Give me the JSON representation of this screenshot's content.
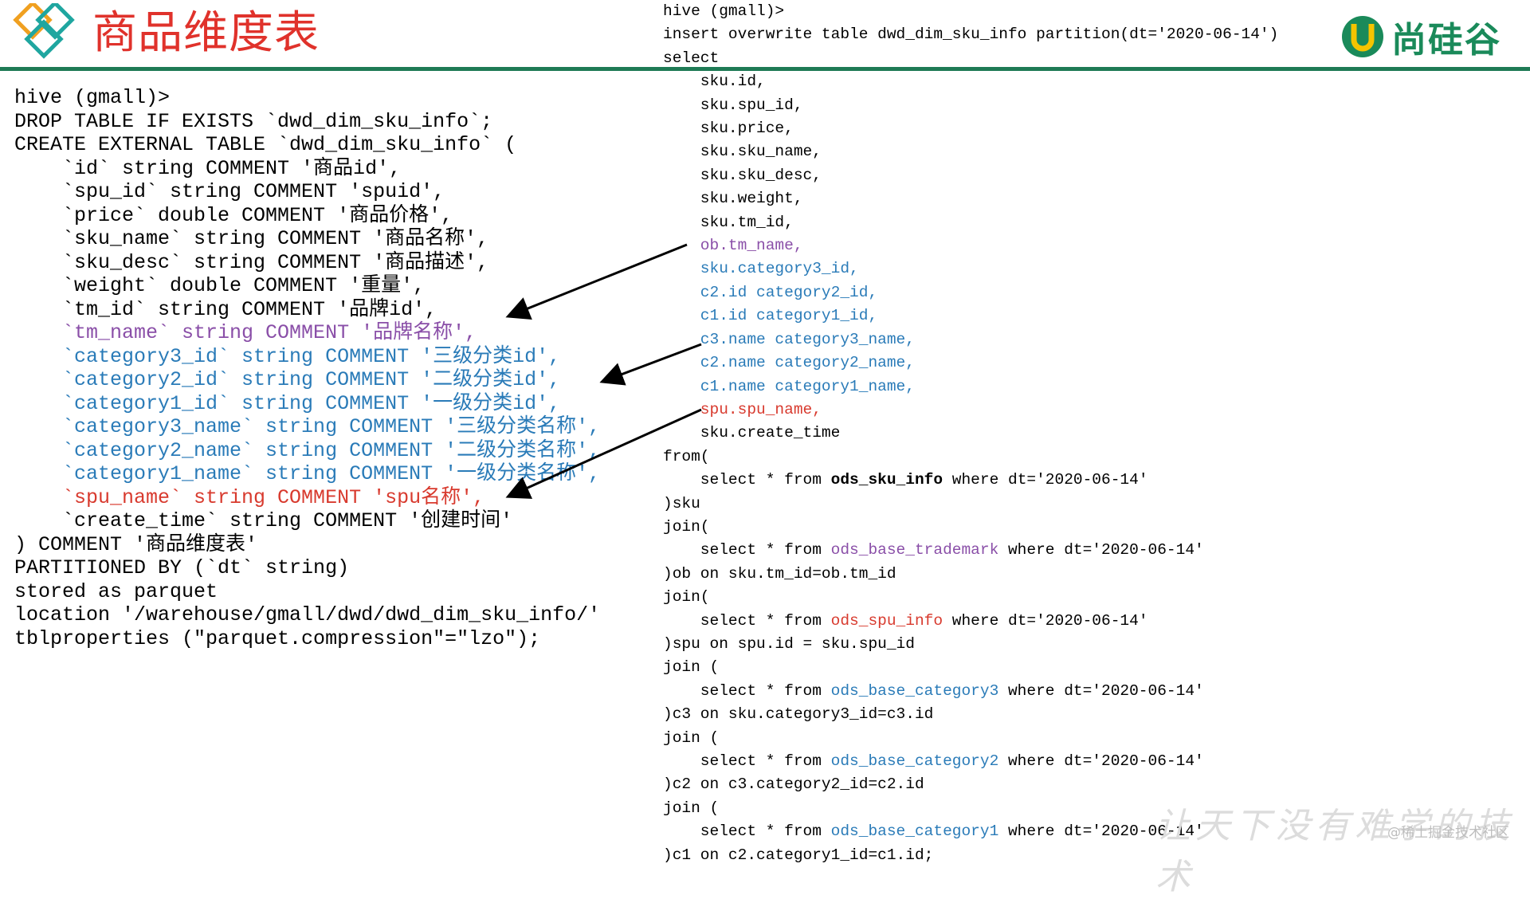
{
  "header": {
    "title": "商品维度表",
    "brand": "尚硅谷",
    "accent_color": "#1e7a55",
    "title_color": "#e0322b"
  },
  "left_code": [
    {
      "text": "hive (gmall)>",
      "color": "default"
    },
    {
      "text": "DROP TABLE IF EXISTS `dwd_dim_sku_info`;",
      "color": "default"
    },
    {
      "text": "CREATE EXTERNAL TABLE `dwd_dim_sku_info` (",
      "color": "default"
    },
    {
      "text": "    `id` string COMMENT '商品id',",
      "color": "default"
    },
    {
      "text": "    `spu_id` string COMMENT 'spuid',",
      "color": "default"
    },
    {
      "text": "    `price` double COMMENT '商品价格',",
      "color": "default"
    },
    {
      "text": "    `sku_name` string COMMENT '商品名称',",
      "color": "default"
    },
    {
      "text": "    `sku_desc` string COMMENT '商品描述',",
      "color": "default"
    },
    {
      "text": "    `weight` double COMMENT '重量',",
      "color": "default"
    },
    {
      "text": "    `tm_id` string COMMENT '品牌id',",
      "color": "default"
    },
    {
      "text": "    `tm_name` string COMMENT '品牌名称',",
      "color": "purple"
    },
    {
      "text": "    `category3_id` string COMMENT '三级分类id',",
      "color": "blue"
    },
    {
      "text": "    `category2_id` string COMMENT '二级分类id',",
      "color": "blue"
    },
    {
      "text": "    `category1_id` string COMMENT '一级分类id',",
      "color": "blue"
    },
    {
      "text": "    `category3_name` string COMMENT '三级分类名称',",
      "color": "blue"
    },
    {
      "text": "    `category2_name` string COMMENT '二级分类名称',",
      "color": "blue"
    },
    {
      "text": "    `category1_name` string COMMENT '一级分类名称',",
      "color": "blue"
    },
    {
      "text": "    `spu_name` string COMMENT 'spu名称',",
      "color": "red"
    },
    {
      "text": "    `create_time` string COMMENT '创建时间'",
      "color": "default"
    },
    {
      "text": ") COMMENT '商品维度表'",
      "color": "default"
    },
    {
      "text": "PARTITIONED BY (`dt` string)",
      "color": "default"
    },
    {
      "text": "stored as parquet",
      "color": "default"
    },
    {
      "text": "location '/warehouse/gmall/dwd/dwd_dim_sku_info/'",
      "color": "default"
    },
    {
      "text": "tblproperties (\"parquet.compression\"=\"lzo\");",
      "color": "default"
    }
  ],
  "right_code": [
    {
      "parts": [
        {
          "t": "hive (gmall)>"
        }
      ]
    },
    {
      "parts": [
        {
          "t": "insert overwrite table dwd_dim_sku_info partition(dt='2020-06-14')"
        }
      ]
    },
    {
      "parts": [
        {
          "t": "select"
        }
      ]
    },
    {
      "parts": [
        {
          "t": "    sku.id,"
        }
      ]
    },
    {
      "parts": [
        {
          "t": "    sku.spu_id,"
        }
      ]
    },
    {
      "parts": [
        {
          "t": "    sku.price,"
        }
      ]
    },
    {
      "parts": [
        {
          "t": "    sku.sku_name,"
        }
      ]
    },
    {
      "parts": [
        {
          "t": "    sku.sku_desc,"
        }
      ]
    },
    {
      "parts": [
        {
          "t": "    sku.weight,"
        }
      ]
    },
    {
      "parts": [
        {
          "t": "    sku.tm_id,"
        }
      ]
    },
    {
      "parts": [
        {
          "t": "    ob.tm_name,",
          "c": "purple"
        }
      ]
    },
    {
      "parts": [
        {
          "t": "    sku.category3_id,",
          "c": "blue"
        }
      ]
    },
    {
      "parts": [
        {
          "t": "    c2.id category2_id,",
          "c": "blue"
        }
      ]
    },
    {
      "parts": [
        {
          "t": "    c1.id category1_id,",
          "c": "blue"
        }
      ]
    },
    {
      "parts": [
        {
          "t": "    c3.name category3_name,",
          "c": "blue"
        }
      ]
    },
    {
      "parts": [
        {
          "t": "    c2.name category2_name,",
          "c": "blue"
        }
      ]
    },
    {
      "parts": [
        {
          "t": "    c1.name category1_name,",
          "c": "blue"
        }
      ]
    },
    {
      "parts": [
        {
          "t": "    spu.spu_name,",
          "c": "red"
        }
      ]
    },
    {
      "parts": [
        {
          "t": "    sku.create_time"
        }
      ]
    },
    {
      "parts": [
        {
          "t": "from("
        }
      ]
    },
    {
      "parts": [
        {
          "t": "    select * from "
        },
        {
          "t": "ods_sku_info",
          "c": "bold"
        },
        {
          "t": " where dt='2020-06-14'"
        }
      ]
    },
    {
      "parts": [
        {
          "t": ")sku"
        }
      ]
    },
    {
      "parts": [
        {
          "t": "join("
        }
      ]
    },
    {
      "parts": [
        {
          "t": "    select * from "
        },
        {
          "t": "ods_base_trademark",
          "c": "purple"
        },
        {
          "t": " where dt='2020-06-14'"
        }
      ]
    },
    {
      "parts": [
        {
          "t": ")ob on sku.tm_id=ob.tm_id"
        }
      ]
    },
    {
      "parts": [
        {
          "t": "join("
        }
      ]
    },
    {
      "parts": [
        {
          "t": "    select * from "
        },
        {
          "t": "ods_spu_info",
          "c": "red"
        },
        {
          "t": " where dt='2020-06-14'"
        }
      ]
    },
    {
      "parts": [
        {
          "t": ")spu on spu.id = sku.spu_id"
        }
      ]
    },
    {
      "parts": [
        {
          "t": "join ("
        }
      ]
    },
    {
      "parts": [
        {
          "t": "    select * from "
        },
        {
          "t": "ods_base_category3",
          "c": "blue"
        },
        {
          "t": " where dt='2020-06-14'"
        }
      ]
    },
    {
      "parts": [
        {
          "t": ")c3 on sku.category3_id=c3.id"
        }
      ]
    },
    {
      "parts": [
        {
          "t": "join ("
        }
      ]
    },
    {
      "parts": [
        {
          "t": "    select * from "
        },
        {
          "t": "ods_base_category2",
          "c": "blue"
        },
        {
          "t": " where dt='2020-06-14'"
        }
      ]
    },
    {
      "parts": [
        {
          "t": ")c2 on c3.category2_id=c2.id"
        }
      ]
    },
    {
      "parts": [
        {
          "t": "join ("
        }
      ]
    },
    {
      "parts": [
        {
          "t": "    select * from "
        },
        {
          "t": "ods_base_category1",
          "c": "blue"
        },
        {
          "t": " where dt='2020-06-14'"
        }
      ]
    },
    {
      "parts": [
        {
          "t": ")c1 on c2.category1_id=c1.id;"
        }
      ]
    }
  ],
  "watermark": "让天下没有难学的技术",
  "credit": "@稀土掘金技术社区"
}
